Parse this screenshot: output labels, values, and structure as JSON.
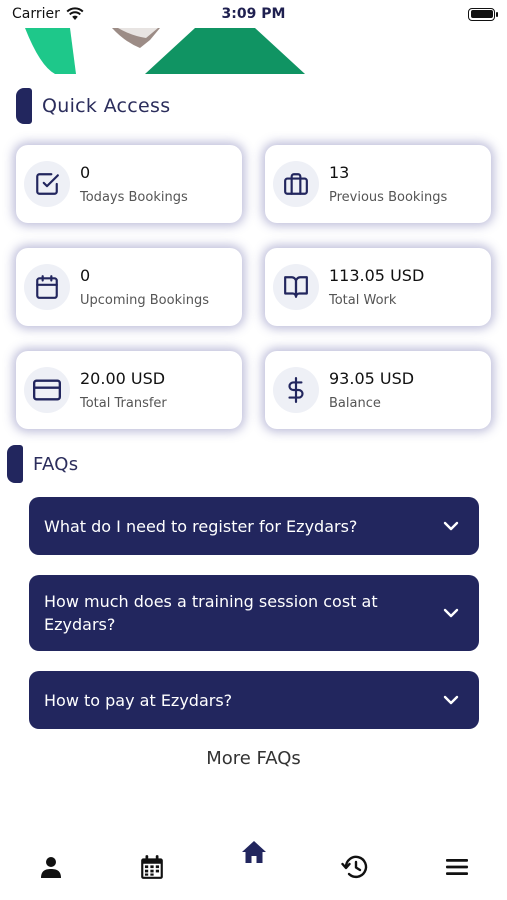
{
  "status_bar": {
    "carrier": "Carrier",
    "time": "3:09 PM"
  },
  "quick_access": {
    "title": "Quick Access",
    "cards": [
      {
        "value": "0",
        "label": "Todays Bookings",
        "icon": "checkbox-icon"
      },
      {
        "value": "13",
        "label": "Previous Bookings",
        "icon": "briefcase-icon"
      },
      {
        "value": "0",
        "label": "Upcoming Bookings",
        "icon": "calendar-icon"
      },
      {
        "value": "113.05 USD",
        "label": "Total Work",
        "icon": "book-icon"
      },
      {
        "value": "20.00 USD",
        "label": "Total Transfer",
        "icon": "credit-card-icon"
      },
      {
        "value": "93.05 USD",
        "label": "Balance",
        "icon": "dollar-icon"
      }
    ]
  },
  "faqs": {
    "title": "FAQs",
    "items": [
      {
        "question": "What do I need to register for Ezydars?"
      },
      {
        "question": "How much does a training session cost at Ezydars?"
      },
      {
        "question": "How to pay at Ezydars?"
      }
    ],
    "more_label": "More FAQs"
  },
  "tabbar": {
    "items": [
      "profile-icon",
      "calendar-icon",
      "home-icon",
      "history-icon",
      "menu-icon"
    ],
    "active": "home-icon"
  },
  "colors": {
    "primary": "#22265e",
    "hero_green": "#109463",
    "hero_mint": "#1ec88a"
  }
}
